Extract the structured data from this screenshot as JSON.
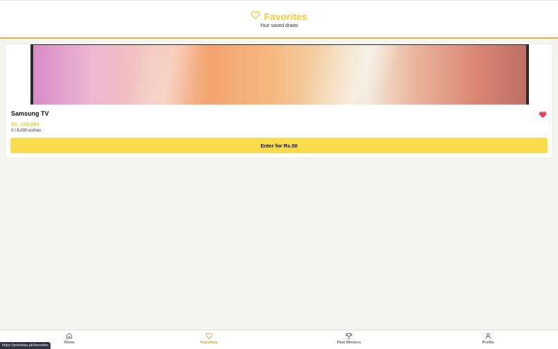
{
  "header": {
    "title": "Favorites",
    "subtitle": "Your saved draws",
    "icon": "heart-outline-icon",
    "accent_color": "#f2cb3a"
  },
  "card": {
    "product_name": "Samsung TV",
    "price": "Rs. 150,000",
    "entries": "0 / 6,000 entries",
    "enter_button_label": "Enter for Rs.50",
    "favorite_icon": "heart-filled-icon",
    "favorite_color": "#e6475a",
    "button_color": "#fadb4c"
  },
  "bottom_nav": {
    "items": [
      {
        "label": "Home",
        "icon": "home-icon",
        "active": false
      },
      {
        "label": "Favorites",
        "icon": "heart-outline-icon",
        "active": true
      },
      {
        "label": "Past Winners",
        "icon": "trophy-icon",
        "active": false
      },
      {
        "label": "Profile",
        "icon": "user-icon",
        "active": false
      }
    ]
  },
  "status_url": "https://jeetobaz.pk/favorites"
}
